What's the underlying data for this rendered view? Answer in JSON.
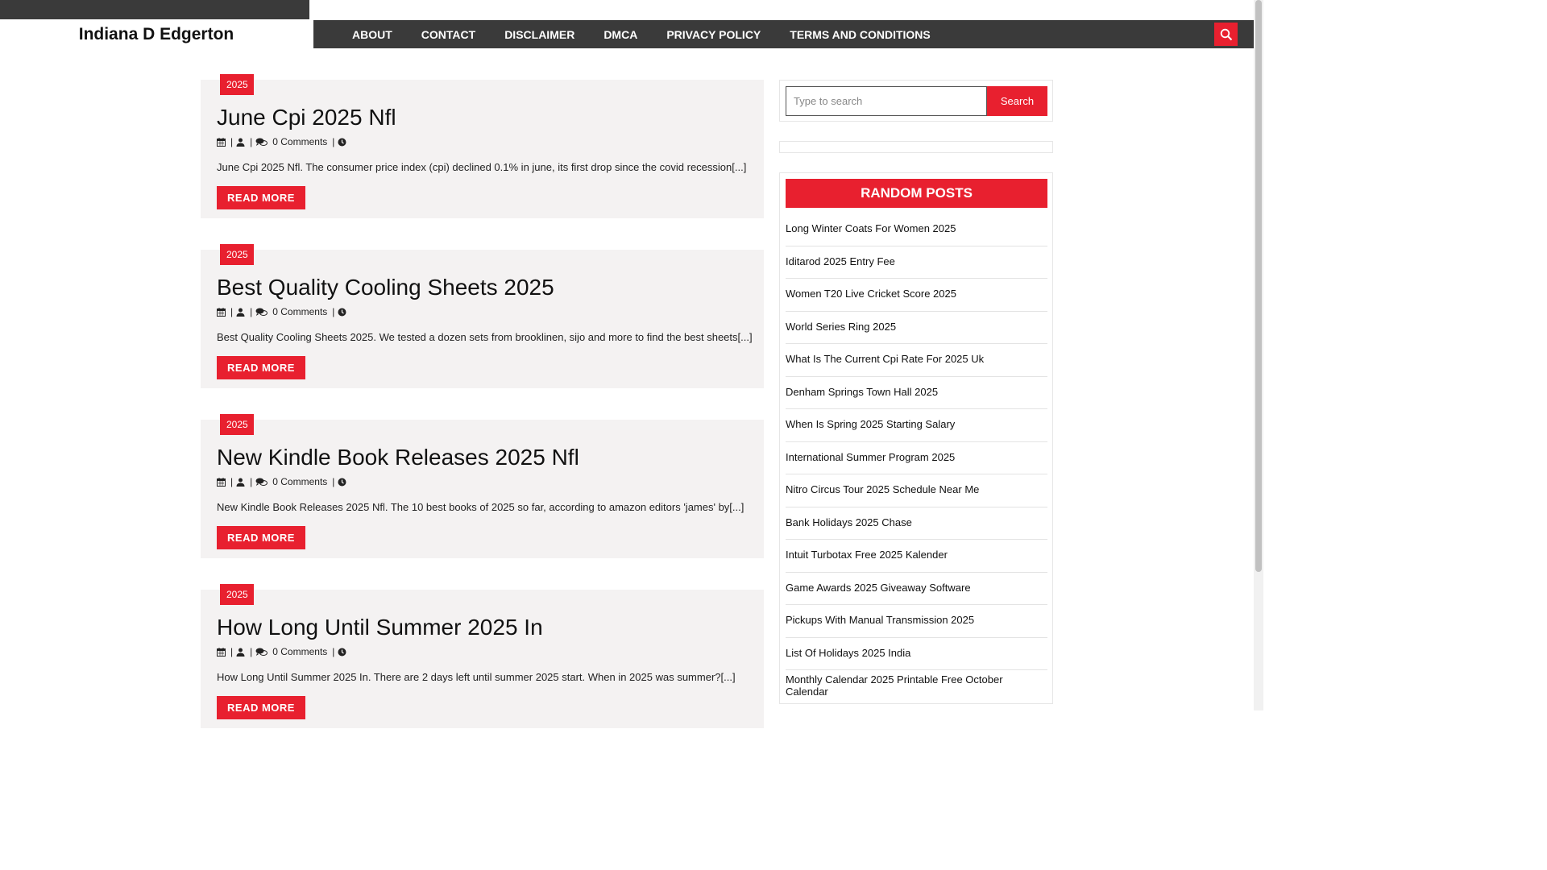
{
  "site": {
    "title": "Indiana D Edgerton"
  },
  "nav": {
    "items": [
      "ABOUT",
      "CONTACT",
      "DISCLAIMER",
      "DMCA",
      "PRIVACY POLICY",
      "TERMS AND CONDITIONS"
    ]
  },
  "posts": [
    {
      "category": "2025",
      "title": "June Cpi 2025 Nfl",
      "comments": "0 Comments",
      "excerpt": "June Cpi 2025 Nfl. The consumer price index (cpi) declined 0.1% in june, its first drop since the covid recession[...]",
      "read_more": "READ MORE"
    },
    {
      "category": "2025",
      "title": "Best Quality Cooling Sheets 2025",
      "comments": "0 Comments",
      "excerpt": "Best Quality Cooling Sheets 2025. We tested a dozen sets from brooklinen, sijo and more to find the best sheets[...]",
      "read_more": "READ MORE"
    },
    {
      "category": "2025",
      "title": "New Kindle Book Releases 2025 Nfl",
      "comments": "0 Comments",
      "excerpt": "New Kindle Book Releases 2025 Nfl. The 10 best books of 2025 so far, according to amazon editors 'james' by[...]",
      "read_more": "READ MORE"
    },
    {
      "category": "2025",
      "title": "How Long Until Summer 2025 In",
      "comments": "0 Comments",
      "excerpt": "How Long Until Summer 2025 In. There are 2 days left until summer 2025 start. When in 2025 was summer?[...]",
      "read_more": "READ MORE"
    }
  ],
  "sidebar": {
    "search": {
      "placeholder": "Type to search",
      "button": "Search"
    },
    "random_posts": {
      "title": "RANDOM POSTS",
      "items": [
        "Long Winter Coats For Women 2025",
        "Iditarod 2025 Entry Fee",
        "Women T20 Live Cricket Score 2025",
        "World Series Ring 2025",
        "What Is The Current Cpi Rate For 2025 Uk",
        "Denham Springs Town Hall 2025",
        "When Is Spring 2025 Starting Salary",
        "International Summer Program 2025",
        "Nitro Circus Tour 2025 Schedule Near Me",
        "Bank Holidays 2025 Chase",
        "Intuit Turbotax Free 2025 Kalender",
        "Game Awards 2025 Giveaway Software",
        "Pickups With Manual Transmission 2025",
        "List Of Holidays 2025 India",
        "Monthly Calendar 2025 Printable Free October Calendar"
      ]
    }
  },
  "colors": {
    "accent": "#e8202f",
    "nav_bg": "#3a3a3a",
    "post_bg": "#f4f2f2"
  }
}
